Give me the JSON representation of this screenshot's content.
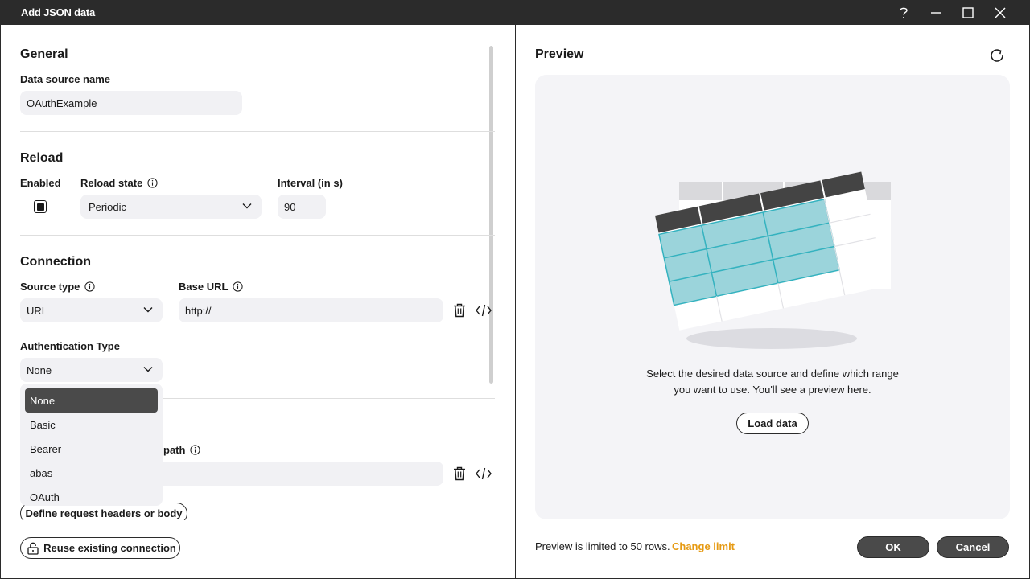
{
  "window": {
    "title": "Add JSON data"
  },
  "general": {
    "heading": "General",
    "datasource_label": "Data source name",
    "datasource_value": "OAuthExample"
  },
  "reload": {
    "heading": "Reload",
    "enabled_label": "Enabled",
    "enabled_checked": true,
    "state_label": "Reload state",
    "state_value": "Periodic",
    "interval_label": "Interval (in s)",
    "interval_value": "90"
  },
  "connection": {
    "heading": "Connection",
    "source_type_label": "Source type",
    "source_type_value": "URL",
    "base_url_label": "Base URL",
    "base_url_value": "http://",
    "auth_label": "Authentication Type",
    "auth_value": "None",
    "auth_options": [
      "None",
      "Basic",
      "Bearer",
      "abas",
      "OAuth"
    ],
    "path_label_partial": "path",
    "define_headers_label": "Define request headers or body",
    "reuse_label": "Reuse existing connection"
  },
  "preview": {
    "heading": "Preview",
    "message_line1": "Select the desired data source and define which range",
    "message_line2": "you want to use. You'll see a preview here.",
    "load_label": "Load data",
    "limit_text": "Preview is limited to 50 rows.",
    "change_limit_label": "Change limit",
    "ok_label": "OK",
    "cancel_label": "Cancel"
  },
  "colors": {
    "accent": "#e69a12",
    "titlebar": "#2b2b2b",
    "field_bg": "#f1f1f4",
    "table_highlight": "#9bd4db"
  }
}
